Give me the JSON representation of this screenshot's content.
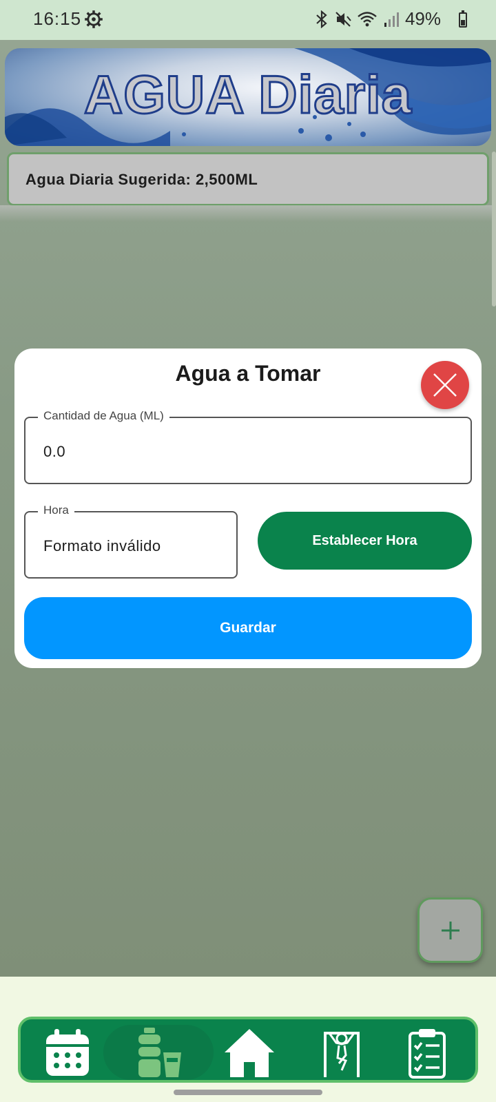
{
  "status_bar": {
    "time": "16:15",
    "battery_text": "49%",
    "icons": [
      "gear-icon",
      "bluetooth-icon",
      "mute-icon",
      "wifi-icon",
      "signal-icon",
      "battery-icon"
    ]
  },
  "header": {
    "banner_title": "AGUA Diaria"
  },
  "suggestion": {
    "text": "Agua Diaria Sugerida: 2,500ML"
  },
  "dialog": {
    "title": "Agua a Tomar",
    "amount_field": {
      "label": "Cantidad de Agua (ML)",
      "value": "0.0"
    },
    "hour_field": {
      "label": "Hora",
      "value": "Formato inválido"
    },
    "set_hour_label": "Establecer Hora",
    "save_label": "Guardar"
  },
  "fab": {
    "icon": "plus-icon"
  },
  "bottom_nav": {
    "items": [
      {
        "name": "calendar",
        "icon": "calendar-icon"
      },
      {
        "name": "water",
        "icon": "water-bottle-icon"
      },
      {
        "name": "home",
        "icon": "home-icon"
      },
      {
        "name": "exercise",
        "icon": "exercise-icon"
      },
      {
        "name": "checklist",
        "icon": "clipboard-checklist-icon"
      }
    ]
  },
  "colors": {
    "primary_green": "#0a834c",
    "save_blue": "#0296ff",
    "close_red": "#e04545",
    "nav_border": "#5fbf6a"
  }
}
